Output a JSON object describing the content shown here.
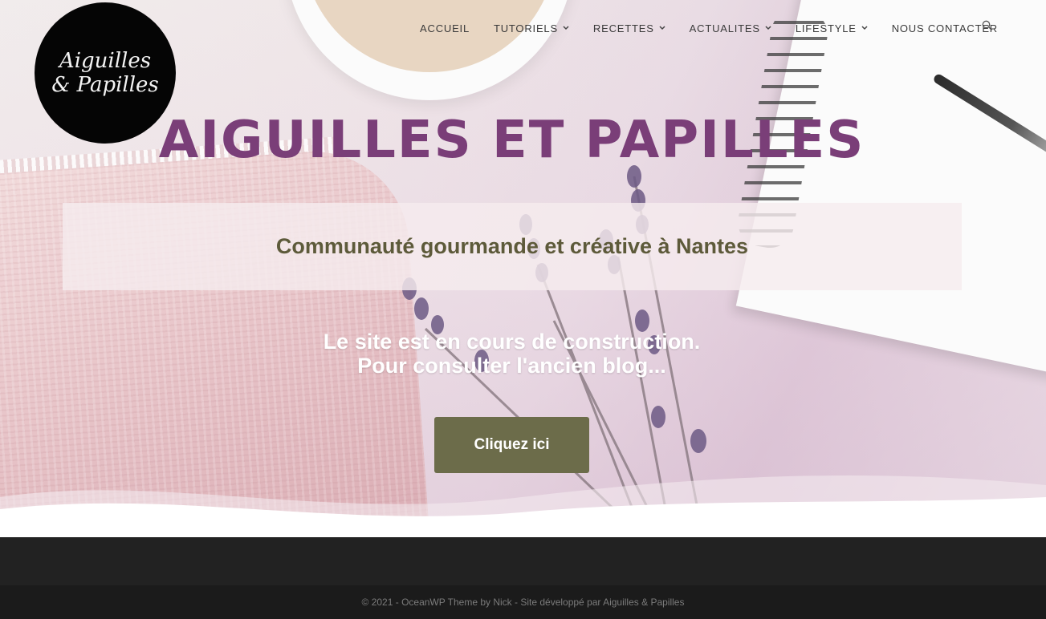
{
  "logo": {
    "line1": "Aiguilles",
    "line2": "& Papilles"
  },
  "nav": {
    "items": [
      {
        "label": "ACCUEIL",
        "has_dropdown": false
      },
      {
        "label": "TUTORIELS",
        "has_dropdown": true
      },
      {
        "label": "RECETTES",
        "has_dropdown": true
      },
      {
        "label": "ACTUALITES",
        "has_dropdown": true
      },
      {
        "label": "LIFESTYLE",
        "has_dropdown": true
      },
      {
        "label": "NOUS CONTACTER",
        "has_dropdown": false
      }
    ],
    "dropdown_icon": "chevron-down-icon",
    "search_icon": "search-icon"
  },
  "hero": {
    "title": "AIGUILLES ET PAPILLES",
    "tagline": "Communauté gourmande et créative à Nantes",
    "notice_line1": "Le site est en cours de construction.",
    "notice_line2": "Pour consulter l'ancien blog...",
    "cta_label": "Cliquez ici"
  },
  "footer": {
    "copyright": "© 2021 - OceanWP Theme by Nick - Site développé par Aiguilles & Papilles"
  },
  "colors": {
    "title": "#7a3e78",
    "tagline": "#5d5a3a",
    "cta_bg": "#6c6c4a",
    "footer_bg": "#1b1b1b"
  }
}
